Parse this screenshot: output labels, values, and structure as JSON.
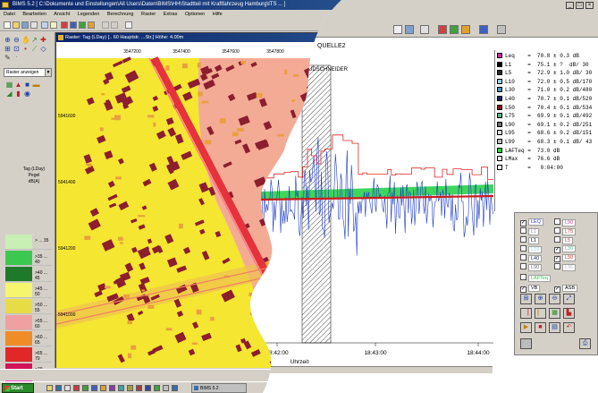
{
  "gis": {
    "title": "BIMS 5.2 [ C:\\Dokumente und Einstellungen\\All Users\\Daten\\BIMS\\HH\\Stadtteil mit Kraftfahrzeug Hamburg\\ITS ... ]",
    "menu": [
      "Datei",
      "Bearbeiten",
      "Ansicht",
      "Legenden",
      "Berechnung",
      "Raster",
      "Extras",
      "Optionen",
      "Hilfe"
    ],
    "layer_select": "Raster anzeigen",
    "legend_caption": [
      "Tag (LDay)",
      "Pegel",
      "dB(A)"
    ],
    "legend": [
      {
        "label": "> ... 35",
        "color": "#c8f0b4"
      },
      {
        "label": ">35 ... 40",
        "color": "#3cc850"
      },
      {
        "label": ">40 ... 45",
        "color": "#1e7a2a"
      },
      {
        "label": ">45 ... 50",
        "color": "#f5f56e"
      },
      {
        "label": ">50 ... 55",
        "color": "#e8dc46"
      },
      {
        "label": ">55 ... 60",
        "color": "#f0a0a0"
      },
      {
        "label": ">60 ... 65",
        "color": "#f08c28"
      },
      {
        "label": ">65 ... 70",
        "color": "#e02828"
      },
      {
        "label": ">70 ... 75",
        "color": "#d2145a"
      },
      {
        "label": ">75 ... 80",
        "color": "#ff50c8"
      },
      {
        "label": ">80",
        "color": "#f0f0f0"
      }
    ],
    "map_title": "Raster: Tag (LDay) [.. 60 Hauptstr. ...Str.]  Höhe: 4.00m",
    "map_ticks_x": [
      "3547200",
      "3547400",
      "3547600",
      "3547800",
      "3548000"
    ],
    "map_ticks_y": [
      "5941600",
      "5941400",
      "5941200",
      "5941000"
    ],
    "map_colors": {
      "base": "#f5e632",
      "road": "#e6323c",
      "building": "#8c1e2d",
      "zone": "#f2a0a8"
    },
    "taskbar": {
      "start": "Start",
      "task": "BIMS 5.2"
    }
  },
  "acou": {
    "window_buttons": [
      "_",
      "□",
      "×"
    ],
    "source_label": "QUELLE2",
    "marker_label": "MUDSCHNEIDER",
    "time_axis": {
      "label": "Uhrzeit",
      "ticks": [
        "18:42:00",
        "18:43:00",
        "18:44:00"
      ]
    },
    "stats": [
      {
        "name": "Leq",
        "value": "=  70.8 ± 0.3 dB",
        "color": "#c82ca0"
      },
      {
        "name": "L1",
        "value": "=  75.1 ± ?  dB/ 30",
        "color": "#000000"
      },
      {
        "name": "L5",
        "value": "=  72.9 ± 1.0 dB/ 30",
        "color": "#2a2a2a"
      },
      {
        "name": "L10",
        "value": "=  72.0 ± 0.5 dB/170",
        "color": "#9fd0e0"
      },
      {
        "name": "L30",
        "value": "=  71.0 ± 0.2 dB/480",
        "color": "#4e8fb8"
      },
      {
        "name": "L40",
        "value": "=  70.7 ± 0.1 dB/520",
        "color": "#16245a"
      },
      {
        "name": "L50",
        "value": "=  70.4 ± 0.1 dB/534",
        "color": "#8c1414"
      },
      {
        "name": "L75",
        "value": "=  69.9 ± 0.1 dB/492",
        "color": "#5ab48c"
      },
      {
        "name": "L90",
        "value": "=  69.1 ± 0.2 dB/251",
        "color": "#6e6e6e"
      },
      {
        "name": "L95",
        "value": "=  68.6 ± 0.2 dB/151",
        "color": "#dcdcdc"
      },
      {
        "name": "L99",
        "value": "=  68.3 ± 0.1 dB/ 43",
        "color": "#bcbcbc"
      },
      {
        "name": "LAFTeq",
        "value": "=  73.0 dB",
        "color": "#2ad24a"
      },
      {
        "name": "LMax",
        "value": "=  76.6 dB",
        "color": "#ffffff"
      },
      {
        "name": "T",
        "value": "=   0:04:00",
        "color": "#ffffff"
      }
    ],
    "checkboxes": [
      {
        "label": "LEQ",
        "checked": true,
        "color": "#3c3cc8"
      },
      {
        "label": "L90",
        "checked": false,
        "color": "#c84a9c"
      },
      {
        "label": "L1",
        "checked": false,
        "color": "#9a9a9a"
      },
      {
        "label": "L75",
        "checked": false,
        "color": "#b04040"
      },
      {
        "label": "L1",
        "checked": false,
        "color": "#000000"
      },
      {
        "label": "L5",
        "checked": false,
        "color": "#b04040"
      },
      {
        "label": "L10",
        "checked": false,
        "color": "#9fd0e0"
      },
      {
        "label": "L30",
        "checked": true,
        "color": "#5ab48c"
      },
      {
        "label": "L40",
        "checked": false,
        "color": "#16245a"
      },
      {
        "label": "L50",
        "checked": true,
        "color": "#e02828"
      },
      {
        "label": "L90",
        "checked": false,
        "color": "#6e6e6e"
      },
      {
        "label": "L95",
        "checked": false,
        "color": "#c0c0c0"
      },
      {
        "label": "LAFTeq",
        "checked": false,
        "color": "#2ad24a"
      },
      {
        "label": "VB",
        "checked": true,
        "color": "#000000"
      },
      {
        "label": "ASB",
        "checked": true,
        "color": "#000000"
      }
    ],
    "chart_colors": {
      "signal": "#1e3cc8",
      "envelope": "#e02828",
      "band": "#2ad24a",
      "level": "#c81e1e"
    },
    "chart_data": {
      "type": "line",
      "x": [
        "18:42:00",
        "18:43:00",
        "18:44:00"
      ],
      "series": [
        {
          "name": "LEQ",
          "values": []
        },
        {
          "name": "L30",
          "values": []
        },
        {
          "name": "L50",
          "values": []
        }
      ],
      "xlabel": "Uhrzeit"
    }
  }
}
